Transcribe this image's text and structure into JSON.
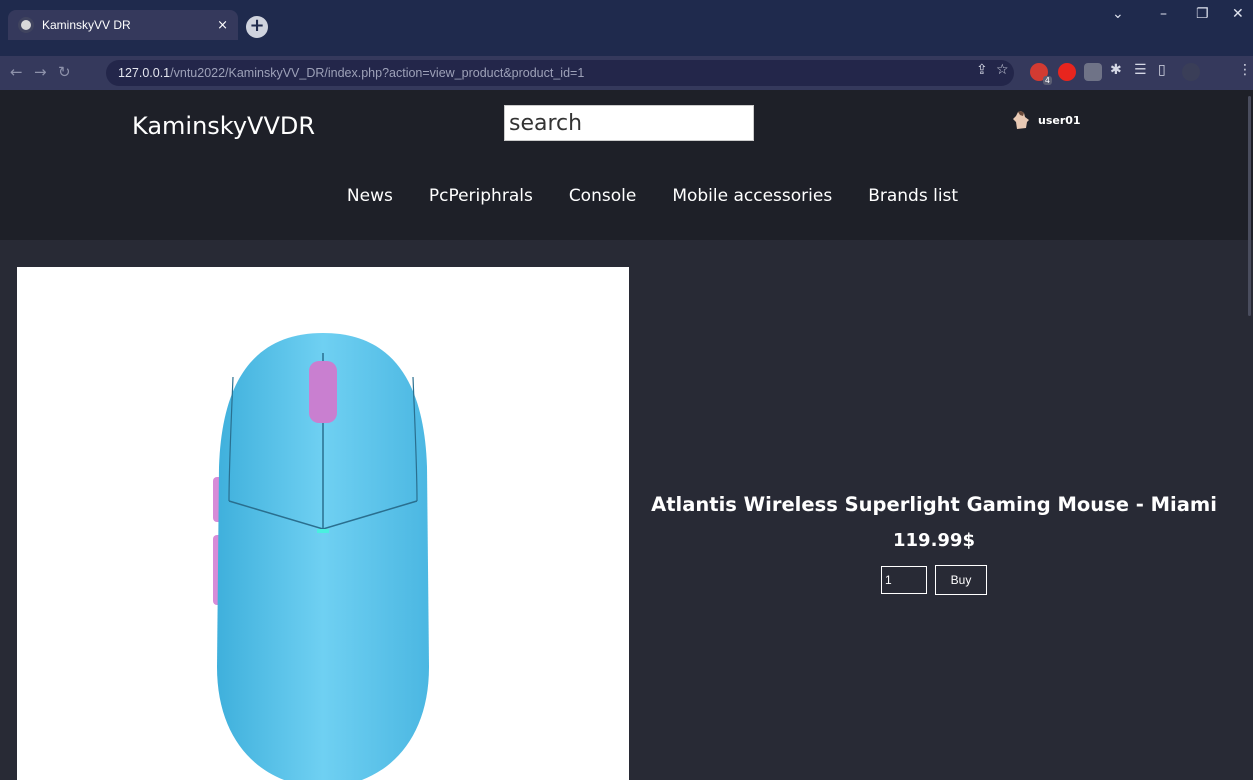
{
  "browser": {
    "tab_title": "KaminskyVV DR",
    "tab_close": "×",
    "new_tab": "+",
    "url_host": "127.0.0.1",
    "url_path": "/vntu2022/KaminskyVV_DR/index.php?action=view_product&product_id=1",
    "window_controls": [
      "⌄",
      "–",
      "❐",
      "✕"
    ],
    "extension_badge": "4"
  },
  "site": {
    "logo": "KaminskyVVDR",
    "search_placeholder": "search",
    "user_name": "user01",
    "nav": [
      "News",
      "PcPeriphrals",
      "Console",
      "Mobile accessories",
      "Brands list"
    ]
  },
  "product": {
    "title": "Atlantis Wireless Superlight Gaming Mouse - Miami",
    "price": "119.99$",
    "quantity": "1",
    "buy_label": "Buy",
    "colors": {
      "body": "#5ec6ec",
      "accent": "#d78bd8"
    }
  }
}
